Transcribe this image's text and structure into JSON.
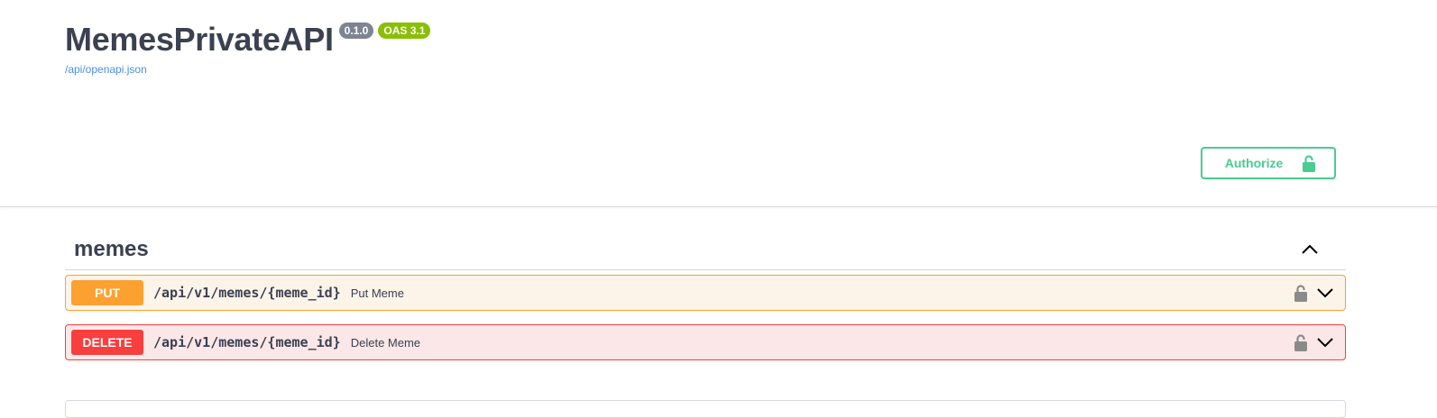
{
  "info": {
    "title": "MemesPrivateAPI",
    "version": "0.1.0",
    "oas_version": "OAS 3.1",
    "spec_url": "/api/openapi.json"
  },
  "authorize": {
    "label": "Authorize",
    "icon": "unlocked-lock-icon"
  },
  "tag": {
    "name": "memes",
    "expanded": true,
    "toggle_icon": "chevron-up-icon"
  },
  "operations": [
    {
      "method": "PUT",
      "path": "/api/v1/memes/{meme_id}",
      "summary": "Put Meme",
      "color": "#fca130"
    },
    {
      "method": "DELETE",
      "path": "/api/v1/memes/{meme_id}",
      "summary": "Delete Meme",
      "color": "#f93e3e"
    }
  ],
  "colors": {
    "authorize": "#49cc90",
    "put": "#fca130",
    "delete": "#f93e3e",
    "version_badge": "#7d8492",
    "oas_badge": "#89bf04",
    "link": "#4990e2"
  }
}
